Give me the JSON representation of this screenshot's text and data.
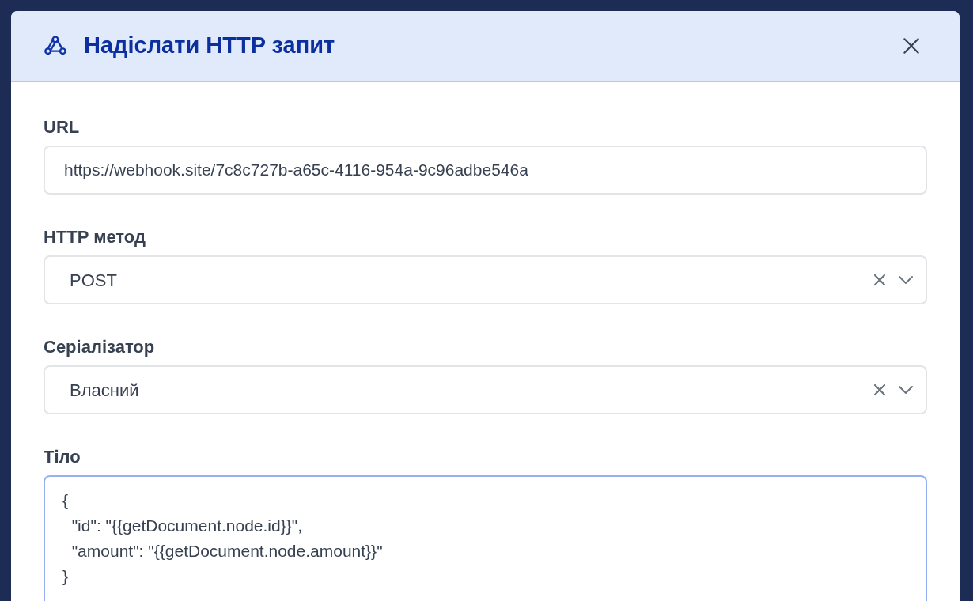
{
  "dialog": {
    "title": "Надіслати HTTP запит"
  },
  "fields": [
    {
      "kind": "text",
      "label": "URL",
      "value": "https://webhook.site/7c8c727b-a65c-4116-954a-9c96adbe546a",
      "focused": false
    },
    {
      "kind": "select",
      "label": "HTTP метод",
      "value": "POST",
      "focused": false
    },
    {
      "kind": "select",
      "label": "Серіалізатор",
      "value": "Власний",
      "focused": false
    },
    {
      "kind": "textarea",
      "label": "Тіло",
      "value": "{\n  \"id\": \"{{getDocument.node.id}}\",\n  \"amount\": \"{{getDocument.node.amount}}\"\n}",
      "focused": true
    }
  ]
}
